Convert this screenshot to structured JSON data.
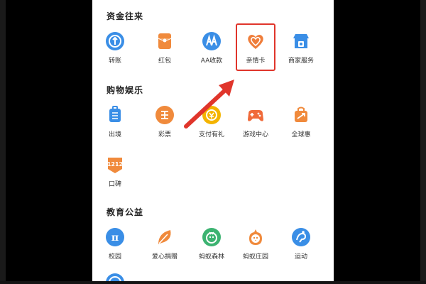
{
  "sections": [
    {
      "title": "资金往来",
      "items": [
        {
          "label": "转账",
          "icon": "transfer-icon",
          "color": "#3a8ee6"
        },
        {
          "label": "红包",
          "icon": "red-packet-icon",
          "color": "#f08a3c"
        },
        {
          "label": "AA收款",
          "icon": "aa-collect-icon",
          "color": "#3a8ee6"
        },
        {
          "label": "亲情卡",
          "icon": "family-card-icon",
          "color": "#ef7d3a"
        },
        {
          "label": "商家服务",
          "icon": "merchant-service-icon",
          "color": "#3a8ee6"
        }
      ]
    },
    {
      "title": "购物娱乐",
      "items": [
        {
          "label": "出境",
          "icon": "outbound-travel-icon",
          "color": "#3a8ee6"
        },
        {
          "label": "彩票",
          "icon": "lottery-icon",
          "color": "#f08a3c"
        },
        {
          "label": "支付有礼",
          "icon": "pay-gift-icon",
          "color": "#f4b400"
        },
        {
          "label": "游戏中心",
          "icon": "game-center-icon",
          "color": "#f06a3a"
        },
        {
          "label": "全球惠",
          "icon": "global-deals-icon",
          "color": "#f08a3c"
        },
        {
          "label": "口碑",
          "icon": "koubei-icon",
          "color": "#f08a3c",
          "glyph": "1212"
        }
      ]
    },
    {
      "title": "教育公益",
      "items": [
        {
          "label": "校园",
          "icon": "campus-icon",
          "color": "#3a8ee6",
          "glyph": "π"
        },
        {
          "label": "爱心捐赠",
          "icon": "charity-donation-icon",
          "color": "#f08a3c"
        },
        {
          "label": "蚂蚁森林",
          "icon": "ant-forest-icon",
          "color": "#3cb371"
        },
        {
          "label": "蚂蚁庄园",
          "icon": "ant-farm-icon",
          "color": "#f08a3c"
        },
        {
          "label": "运动",
          "icon": "sports-icon",
          "color": "#3a8ee6"
        }
      ]
    }
  ],
  "highlight": {
    "target": "亲情卡",
    "color": "#e0352b"
  }
}
